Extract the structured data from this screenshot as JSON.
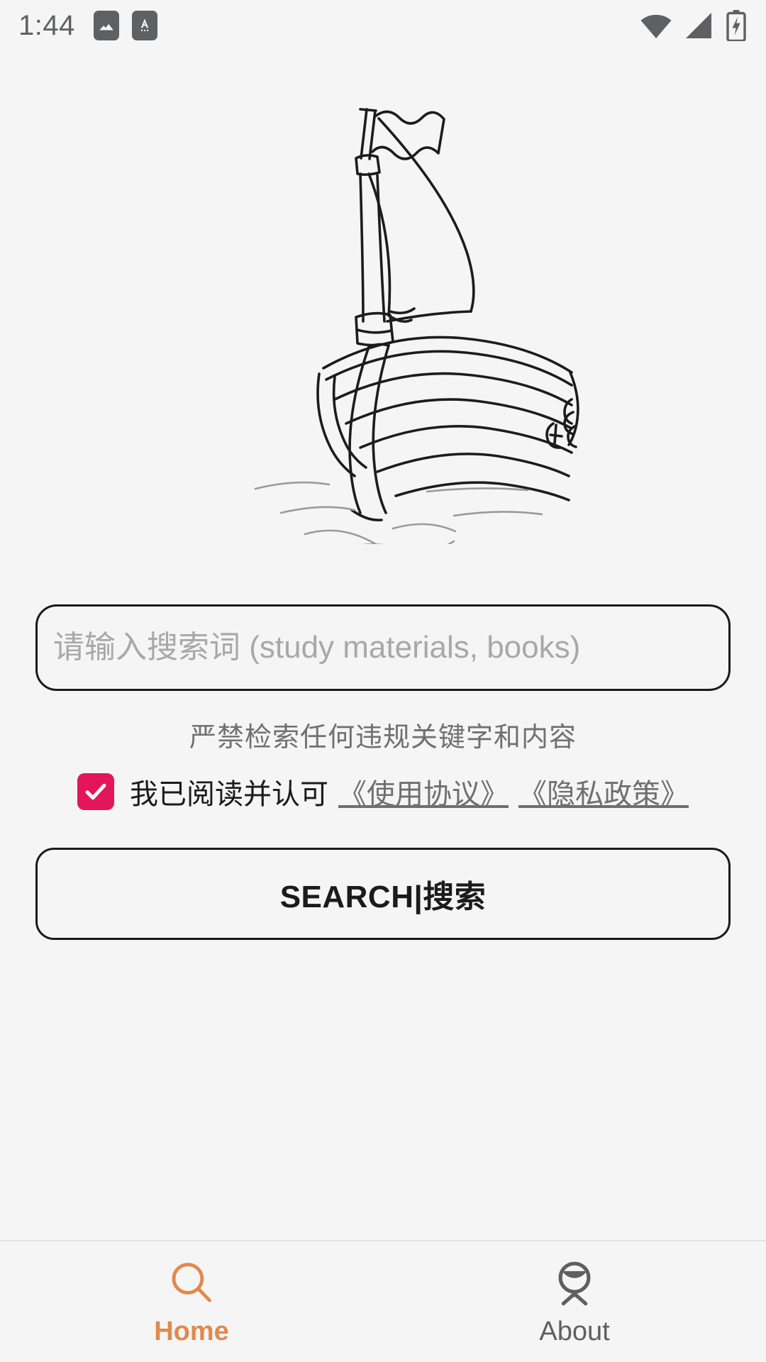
{
  "status_bar": {
    "time": "1:44",
    "left_icons": [
      "image-icon",
      "app-text-icon"
    ],
    "right_icons": [
      "wifi-icon",
      "cell-signal-icon",
      "battery-charging-icon"
    ]
  },
  "illustration": {
    "name": "sailboat-line-art",
    "description": "hand-drawn sailboat with pennant flag on water",
    "stroke_color": "#1c1c1c"
  },
  "search": {
    "placeholder": "请输入搜索词 (study materials, books)",
    "value": "",
    "border_color": "#1a1a1a"
  },
  "warning": {
    "text": "严禁检索任何违规关键字和内容",
    "color": "#707070"
  },
  "agreement": {
    "checked": true,
    "checkbox_color": "#e3165b",
    "check_icon": "check-icon",
    "label": "我已阅读并认可",
    "links": [
      {
        "text": "《使用协议》"
      },
      {
        "text": "《隐私政策》"
      }
    ],
    "link_color": "#6f6f6f"
  },
  "search_button": {
    "label": "SEARCH|搜索"
  },
  "bottom_nav": {
    "active_color": "#e08a4e",
    "inactive_color": "#5f5f5f",
    "items": [
      {
        "label": "Home",
        "icon": "search-magnifier-icon",
        "active": true
      },
      {
        "label": "About",
        "icon": "person-info-icon",
        "active": false
      }
    ]
  }
}
